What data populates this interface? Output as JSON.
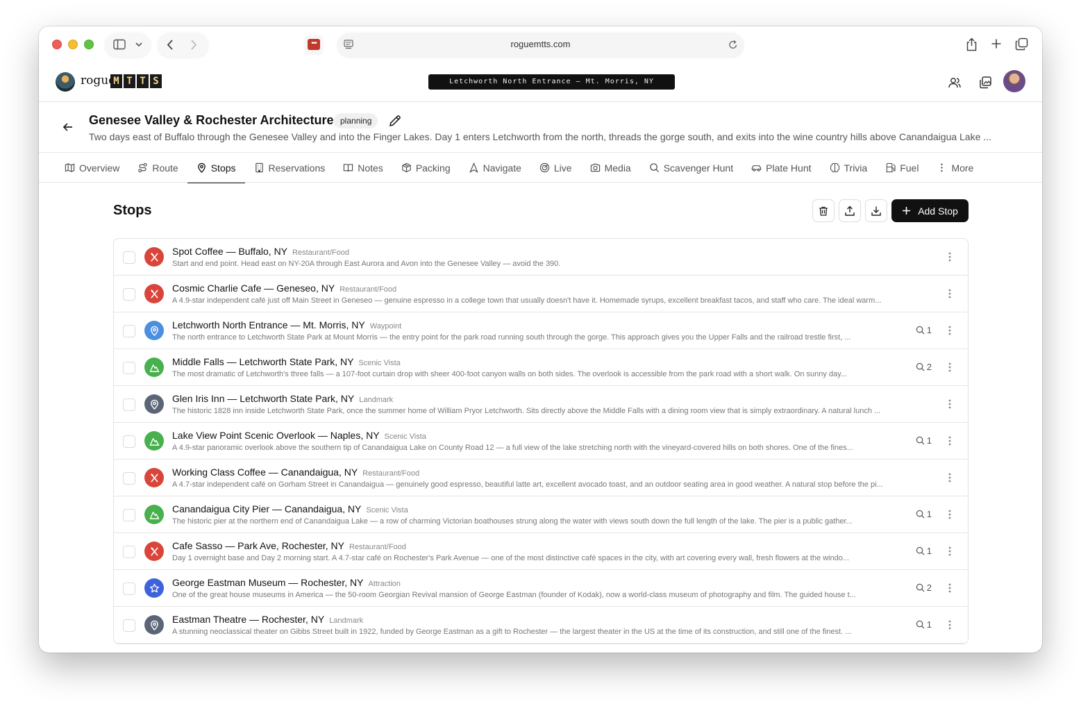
{
  "browser": {
    "url": "roguemtts.com"
  },
  "header": {
    "logo_text": "rogue",
    "logo_blocks": [
      "M",
      "T",
      "T",
      "S"
    ],
    "live_banner": "Letchworth North Entrance — Mt. Morris, NY"
  },
  "trip": {
    "title": "Genesee Valley & Rochester Architecture",
    "status": "planning",
    "description": "Two days east of Buffalo through the Genesee Valley and into the Finger Lakes. Day 1 enters Letchworth from the north, threads the gorge south, and exits into the wine country hills above Canandaigua Lake ..."
  },
  "tabs": [
    {
      "label": "Overview",
      "icon": "map-icon"
    },
    {
      "label": "Route",
      "icon": "route-icon"
    },
    {
      "label": "Stops",
      "icon": "map-pin-icon"
    },
    {
      "label": "Reservations",
      "icon": "building-icon"
    },
    {
      "label": "Notes",
      "icon": "book-icon"
    },
    {
      "label": "Packing",
      "icon": "package-icon"
    },
    {
      "label": "Navigate",
      "icon": "navigation-icon"
    },
    {
      "label": "Live",
      "icon": "radar-icon"
    },
    {
      "label": "Media",
      "icon": "camera-icon"
    },
    {
      "label": "Scavenger Hunt",
      "icon": "search-icon"
    },
    {
      "label": "Plate Hunt",
      "icon": "car-icon"
    },
    {
      "label": "Trivia",
      "icon": "brain-icon"
    },
    {
      "label": "Fuel",
      "icon": "fuel-icon"
    },
    {
      "label": "More",
      "icon": "more-vertical-icon"
    }
  ],
  "active_tab": "Stops",
  "stops_section": {
    "title": "Stops",
    "add_label": "Add Stop"
  },
  "colors": {
    "restaurant": "#d9453a",
    "waypoint": "#4c8fe0",
    "scenic": "#49b04e",
    "landmark": "#5c6578",
    "attraction": "#3d62dc"
  },
  "stops": [
    {
      "name": "Spot Coffee — Buffalo, NY",
      "category": "Restaurant/Food",
      "type": "restaurant",
      "comments": "",
      "description": "Start and end point. Head east on NY-20A through East Aurora and Avon into the Genesee Valley — avoid the 390."
    },
    {
      "name": "Cosmic Charlie Cafe — Geneseo, NY",
      "category": "Restaurant/Food",
      "type": "restaurant",
      "comments": "",
      "description": "A 4.9-star independent café just off Main Street in Geneseo — genuine espresso in a college town that usually doesn't have it. Homemade syrups, excellent breakfast tacos, and staff who care. The ideal warm..."
    },
    {
      "name": "Letchworth North Entrance — Mt. Morris, NY",
      "category": "Waypoint",
      "type": "waypoint",
      "comments": "1",
      "description": "The north entrance to Letchworth State Park at Mount Morris — the entry point for the park road running south through the gorge. This approach gives you the Upper Falls and the railroad trestle first, ..."
    },
    {
      "name": "Middle Falls — Letchworth State Park, NY",
      "category": "Scenic Vista",
      "type": "scenic",
      "comments": "2",
      "description": "The most dramatic of Letchworth's three falls — a 107-foot curtain drop with sheer 400-foot canyon walls on both sides. The overlook is accessible from the park road with a short walk. On sunny day..."
    },
    {
      "name": "Glen Iris Inn — Letchworth State Park, NY",
      "category": "Landmark",
      "type": "landmark",
      "comments": "",
      "description": "The historic 1828 inn inside Letchworth State Park, once the summer home of William Pryor Letchworth. Sits directly above the Middle Falls with a dining room view that is simply extraordinary. A natural lunch ..."
    },
    {
      "name": "Lake View Point Scenic Overlook — Naples, NY",
      "category": "Scenic Vista",
      "type": "scenic",
      "comments": "1",
      "description": "A 4.9-star panoramic overlook above the southern tip of Canandaigua Lake on County Road 12 — a full view of the lake stretching north with the vineyard-covered hills on both shores. One of the fines..."
    },
    {
      "name": "Working Class Coffee — Canandaigua, NY",
      "category": "Restaurant/Food",
      "type": "restaurant",
      "comments": "",
      "description": "A 4.7-star independent café on Gorham Street in Canandaigua — genuinely good espresso, beautiful latte art, excellent avocado toast, and an outdoor seating area in good weather. A natural stop before the pi..."
    },
    {
      "name": "Canandaigua City Pier — Canandaigua, NY",
      "category": "Scenic Vista",
      "type": "scenic",
      "comments": "1",
      "description": "The historic pier at the northern end of Canandaigua Lake — a row of charming Victorian boathouses strung along the water with views south down the full length of the lake. The pier is a public gather..."
    },
    {
      "name": "Cafe Sasso — Park Ave, Rochester, NY",
      "category": "Restaurant/Food",
      "type": "restaurant",
      "comments": "1",
      "description": "Day 1 overnight base and Day 2 morning start. A 4.7-star café on Rochester's Park Avenue — one of the most distinctive café spaces in the city, with art covering every wall, fresh flowers at the windo..."
    },
    {
      "name": "George Eastman Museum — Rochester, NY",
      "category": "Attraction",
      "type": "attraction",
      "comments": "2",
      "description": "One of the great house museums in America — the 50-room Georgian Revival mansion of George Eastman (founder of Kodak), now a world-class museum of photography and film. The guided house t..."
    },
    {
      "name": "Eastman Theatre — Rochester, NY",
      "category": "Landmark",
      "type": "landmark",
      "comments": "1",
      "description": "A stunning neoclassical theater on Gibbs Street built in 1922, funded by George Eastman as a gift to Rochester — the largest theater in the US at the time of its construction, and still one of the finest. ..."
    }
  ]
}
